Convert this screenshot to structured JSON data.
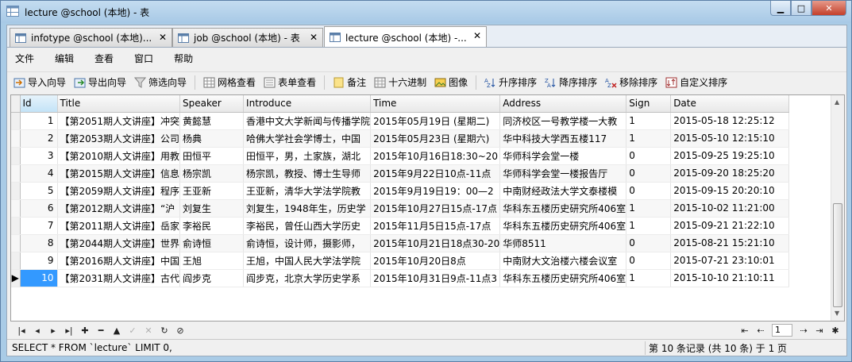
{
  "window": {
    "title": "lecture @school (本地) - 表",
    "controls": {
      "minimize": "▁",
      "maximize": "□",
      "close": "✕"
    }
  },
  "tabs": [
    {
      "label": "infotype @school (本地)...",
      "close": "✕",
      "icon": "table-icon",
      "active": false
    },
    {
      "label": "job @school (本地) - 表",
      "close": "✕",
      "icon": "table-icon",
      "active": false
    },
    {
      "label": "lecture @school (本地) -...",
      "close": "✕",
      "icon": "table-icon",
      "active": true
    }
  ],
  "menu": [
    "文件",
    "编辑",
    "查看",
    "窗口",
    "帮助"
  ],
  "toolbar": {
    "import": "导入向导",
    "export": "导出向导",
    "filter": "筛选向导",
    "grid_view": "网格查看",
    "form_view": "表单查看",
    "memo": "备注",
    "hex": "十六进制",
    "image": "图像",
    "sort_asc": "升序排序",
    "sort_desc": "降序排序",
    "remove_sort": "移除排序",
    "custom_sort": "自定义排序"
  },
  "table": {
    "columns": [
      "Id",
      "Title",
      "Speaker",
      "Introduce",
      "Time",
      "Address",
      "Sign",
      "Date"
    ],
    "rows": [
      [
        "1",
        "【第2051期人文讲座】冲突",
        "黄懿慧",
        "香港中文大学新闻与传播学院",
        "2015年05月19日 (星期二)",
        "同济校区一号教学楼一大教",
        "1",
        "2015-05-18 12:25:12"
      ],
      [
        "2",
        "【第2053期人文讲座】公司",
        "杨典",
        "哈佛大学社会学博士，中国",
        "2015年05月23日 (星期六)",
        "华中科技大学西五楼117",
        "1",
        "2015-05-10 12:15:10"
      ],
      [
        "3",
        "【第2010期人文讲座】用教",
        "田恒平",
        "田恒平，男，土家族，湖北",
        "2015年10月16日18:30~20",
        "华师科学会堂一楼",
        "0",
        "2015-09-25 19:25:10"
      ],
      [
        "4",
        "【第2015期人文讲座】信息",
        "杨宗凯",
        "杨宗凯，教授、博士生导师",
        "2015年9月22日10点-11点",
        "华师科学会堂一楼报告厅",
        "0",
        "2015-09-20 18:25:20"
      ],
      [
        "5",
        "【第2059期人文讲座】程序",
        "王亚新",
        "王亚新，清华大学法学院教",
        "2015年9月19日19：00—2",
        "中南财经政法大学文泰楼模",
        "0",
        "2015-09-15 20:20:10"
      ],
      [
        "6",
        "【第2012期人文讲座】“沪",
        "刘复生",
        "刘复生，1948年生，历史学",
        "2015年10月27日15点-17点",
        "华科东五楼历史研究所406室",
        "1",
        "2015-10-02 11:21:00"
      ],
      [
        "7",
        "【第2011期人文讲座】岳家",
        "李裕民",
        "李裕民，曾任山西大学历史",
        "2015年11月5日15点-17点",
        "华科东五楼历史研究所406室",
        "1",
        "2015-09-21 21:22:10"
      ],
      [
        "8",
        "【第2044期人文讲座】世界",
        "俞诗恒",
        "俞诗恒，设计师，摄影师，",
        "2015年10月21日18点30-20",
        "华师8511",
        "0",
        "2015-08-21 15:21:10"
      ],
      [
        "9",
        "【第2016期人文讲座】中国",
        "王旭",
        "王旭，中国人民大学法学院",
        "2015年10月20日8点",
        "中南财大文治楼六楼会议室",
        "0",
        "2015-07-21 23:10:01"
      ],
      [
        "10",
        "【第2031期人文讲座】古代",
        "阎步克",
        "阎步克，北京大学历史学系",
        "2015年10月31日9点-11点3",
        "华科东五楼历史研究所406室",
        "1",
        "2015-10-10 21:10:11"
      ]
    ],
    "current_row": 10,
    "row_indicator": "▶"
  },
  "navigator": {
    "buttons": [
      "|◂",
      "◂",
      "▸",
      "▸|",
      "✚",
      "━",
      "▲",
      "✓",
      "✕",
      "↻",
      "⊘"
    ],
    "page": "1"
  },
  "status": {
    "sql": "SELECT * FROM `lecture` LIMIT 0,",
    "records": "第 10 条记录 (共 10 条) 于 1 页"
  },
  "colors": {
    "selection": "#3399ff",
    "window_frame": "#a9cbe6"
  }
}
